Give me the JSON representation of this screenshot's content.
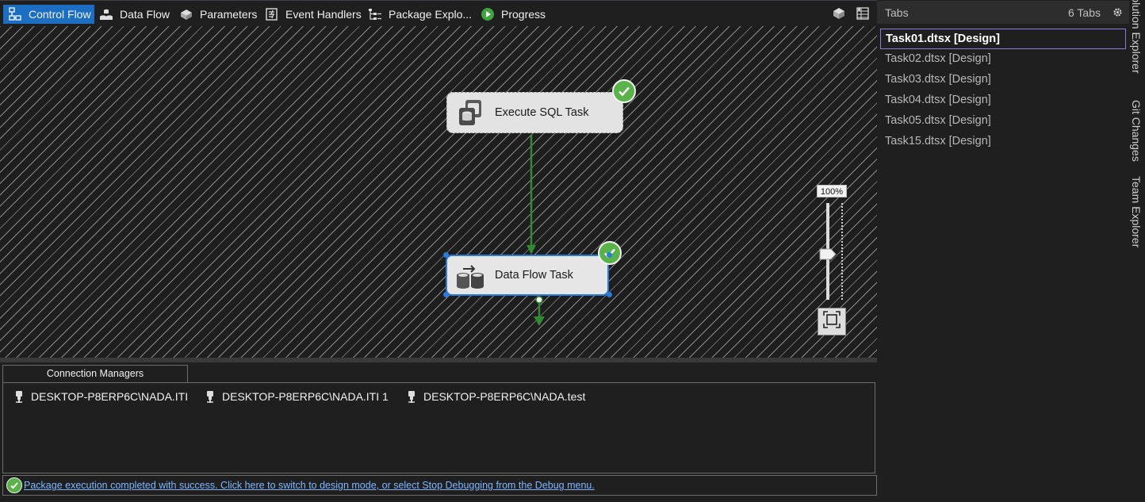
{
  "designer_tabs": [
    {
      "label": "Control Flow",
      "icon": "control-flow-icon",
      "active": true
    },
    {
      "label": "Data Flow",
      "icon": "data-flow-icon",
      "active": false
    },
    {
      "label": "Parameters",
      "icon": "parameters-icon",
      "active": false
    },
    {
      "label": "Event Handlers",
      "icon": "event-handlers-icon",
      "active": false
    },
    {
      "label": "Package Explo...",
      "icon": "package-explorer-icon",
      "active": false
    },
    {
      "label": "Progress",
      "icon": "progress-play-icon",
      "active": false
    }
  ],
  "canvas": {
    "tasks": [
      {
        "name": "Execute SQL Task",
        "status": "success",
        "selected": false
      },
      {
        "name": "Data Flow Task",
        "status": "success",
        "selected": true
      }
    ],
    "zoom_label": "100%"
  },
  "connection_managers": {
    "tab_label": "Connection Managers",
    "items": [
      "DESKTOP-P8ERP6C\\NADA.ITI",
      "DESKTOP-P8ERP6C\\NADA.ITI 1",
      "DESKTOP-P8ERP6C\\NADA.test"
    ]
  },
  "status_bar": {
    "message": "Package execution completed with success. Click here to switch to design mode, or select Stop Debugging from the Debug menu."
  },
  "tabs_window": {
    "title": "Tabs",
    "count": "6 Tabs",
    "items": [
      {
        "label": "Task01.dtsx [Design]",
        "active": true
      },
      {
        "label": "Task02.dtsx [Design]",
        "active": false
      },
      {
        "label": "Task03.dtsx [Design]",
        "active": false
      },
      {
        "label": "Task04.dtsx [Design]",
        "active": false
      },
      {
        "label": "Task05.dtsx [Design]",
        "active": false
      },
      {
        "label": "Task15.dtsx [Design]",
        "active": false
      }
    ]
  },
  "side_tool_windows": [
    "Solution Explorer",
    "Git Changes",
    "Team Explorer"
  ],
  "colors": {
    "accent": "#1c6ec2",
    "success": "#5ab24a",
    "link": "#7fb7ff",
    "selection_border": "#2b7bd9",
    "active_tab_border": "#8e7bd8"
  }
}
